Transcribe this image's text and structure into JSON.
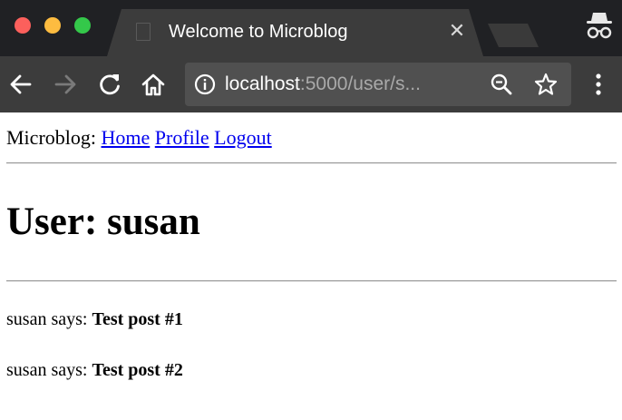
{
  "browser": {
    "tab": {
      "title": "Welcome to Microblog"
    },
    "address_bar": {
      "host": "localhost",
      "rest": ":5000/user/s..."
    }
  },
  "page": {
    "nav": {
      "brand": "Microblog:",
      "links": [
        {
          "label": "Home"
        },
        {
          "label": "Profile"
        },
        {
          "label": "Logout"
        }
      ]
    },
    "title": "User: susan",
    "posts": [
      {
        "author": "susan",
        "verb": "says:",
        "body": "Test post #1"
      },
      {
        "author": "susan",
        "verb": "says:",
        "body": "Test post #2"
      }
    ]
  },
  "colors": {
    "titlebar": "#202124",
    "tab": "#3c3c3c",
    "toolbar": "#3c3c3c",
    "omnibox": "#505050",
    "link": "#0000ee",
    "traffic_close": "#fc605c",
    "traffic_min": "#fdbc40",
    "traffic_max": "#34c84a"
  },
  "icons": [
    "document-icon",
    "close-icon",
    "incognito-icon",
    "back-arrow-icon",
    "forward-arrow-icon",
    "reload-icon",
    "home-icon",
    "info-icon",
    "zoom-out-icon",
    "star-icon",
    "more-vertical-icon"
  ]
}
